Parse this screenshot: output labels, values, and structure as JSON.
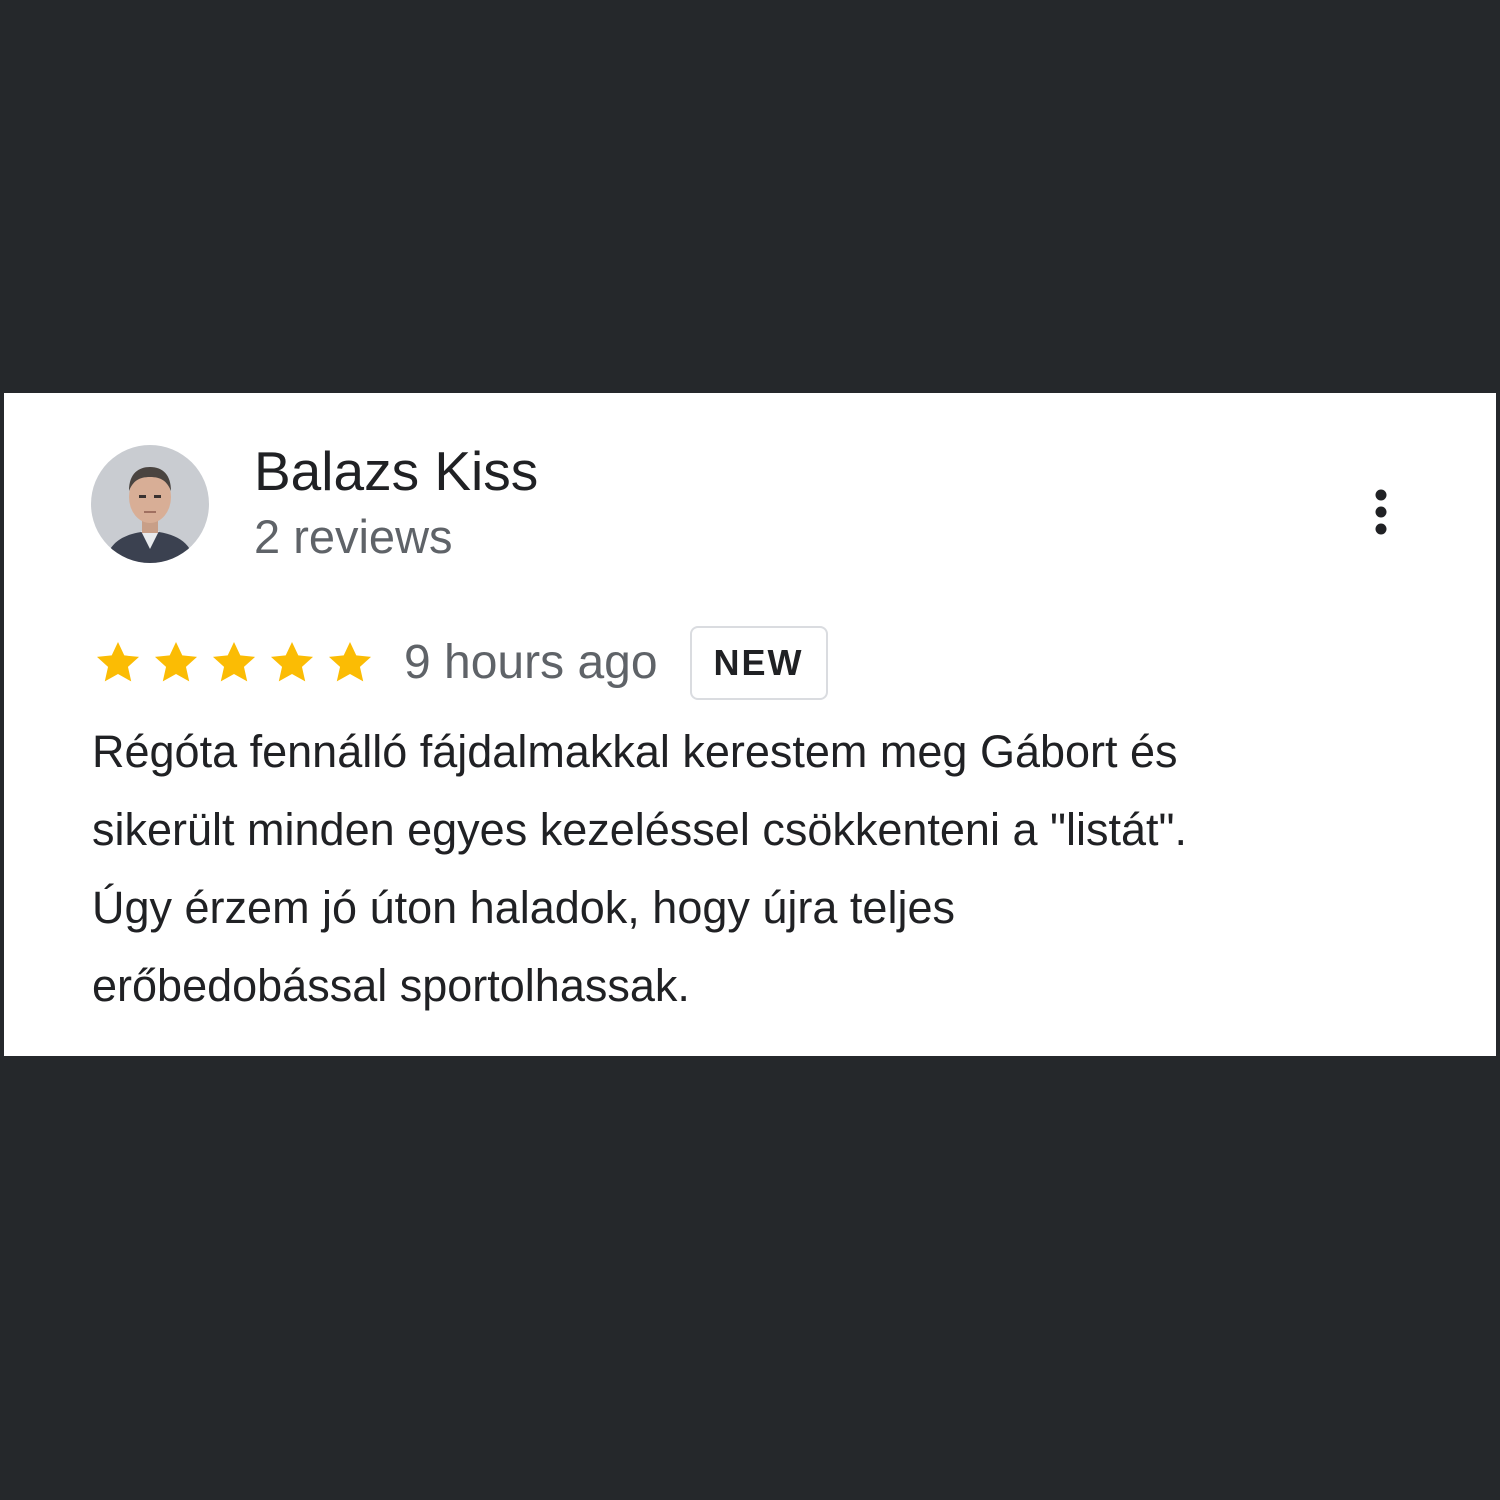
{
  "review": {
    "author_name": "Balazs Kiss",
    "review_count": "2 reviews",
    "avatar_icon": "profile-photo",
    "menu_icon": "more-vert-icon",
    "rating": 5,
    "rating_max": 5,
    "star_color": "#fbbc04",
    "time_ago": "9 hours ago",
    "badge": "NEW",
    "text_lines": [
      "Régóta fennálló fájdalmakkal kerestem meg Gábort és",
      "sikerült minden egyes kezeléssel csökkenteni a \"listát\".",
      "Úgy érzem jó úton haladok, hogy újra teljes",
      "erőbedobással sportolhassak."
    ]
  }
}
